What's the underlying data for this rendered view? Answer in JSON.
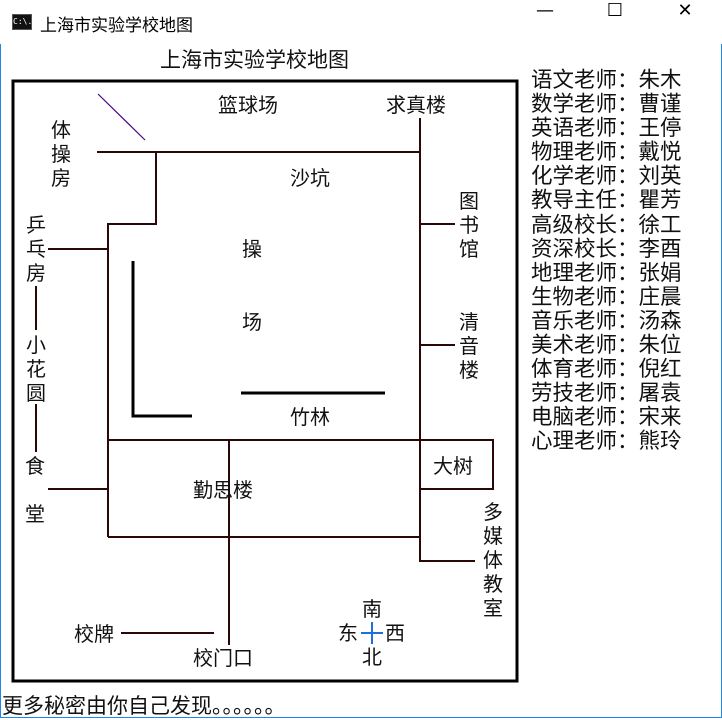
{
  "window": {
    "title": "上海市实验学校地图",
    "icon": "console-icon",
    "icon_text": "C:\\.",
    "minimize": "—",
    "maximize": "☐",
    "close": "✕"
  },
  "map": {
    "title": "上海市实验学校地图",
    "labels": {
      "basketball": "篮球场",
      "qiuzhen": "求真楼",
      "gym": "体操房",
      "sandpit": "沙坑",
      "library": "图书馆",
      "pingpong": "乒乓房",
      "playground1": "操",
      "playground2": "场",
      "qingyin": "清音楼",
      "garden": "小花圆",
      "bamboo": "竹林",
      "canteen1": "食",
      "canteen2": "堂",
      "bigtree": "大树",
      "qinsi": "勤思楼",
      "multimedia": "多媒体教室",
      "sign": "校牌",
      "gate": "校门口",
      "south": "南",
      "east": "东",
      "west": "西",
      "north": "北"
    },
    "colors": {
      "line": "#3a0a0a",
      "diagonal": "#4b0082",
      "compass": "#1e6fd9"
    }
  },
  "staff": [
    {
      "role": "语文老师：",
      "name": "朱木"
    },
    {
      "role": "数学老师：",
      "name": "曹谨"
    },
    {
      "role": "英语老师：",
      "name": "王停"
    },
    {
      "role": "物理老师：",
      "name": "戴悦"
    },
    {
      "role": "化学老师：",
      "name": "刘英"
    },
    {
      "role": "教导主任：",
      "name": "瞿芳"
    },
    {
      "role": "高级校长：",
      "name": "徐工"
    },
    {
      "role": "资深校长：",
      "name": "李酉"
    },
    {
      "role": "地理老师：",
      "name": "张娟"
    },
    {
      "role": "生物老师：",
      "name": "庄晨"
    },
    {
      "role": "音乐老师：",
      "name": "汤森"
    },
    {
      "role": "美术老师：",
      "name": "朱位"
    },
    {
      "role": "体育老师：",
      "name": "倪红"
    },
    {
      "role": "劳技老师：",
      "name": "屠袁"
    },
    {
      "role": "电脑老师：",
      "name": "宋来"
    },
    {
      "role": "心理老师：",
      "name": "熊玲"
    }
  ],
  "footer": "更多秘密由你自己发现。。。。。。"
}
